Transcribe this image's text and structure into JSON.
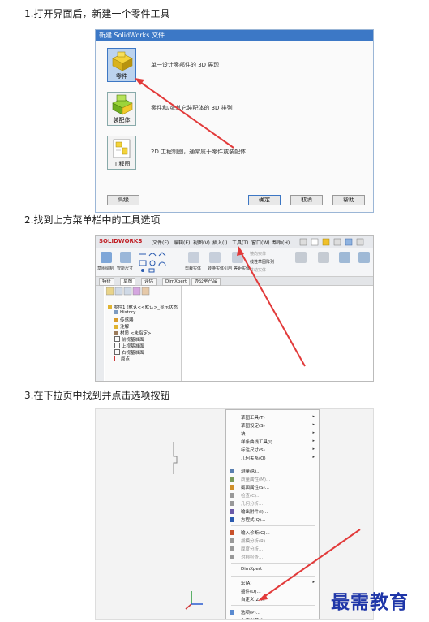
{
  "steps": {
    "s1": "1.打开界面后，新建一个零件工具",
    "s2": "2.找到上方菜单栏中的工具选项",
    "s3": "3.在下拉页中找到并点击选项按钮"
  },
  "dialog": {
    "title": "新建 SolidWorks 文件",
    "items": [
      {
        "label": "零件",
        "desc": "单一设计零部件的 3D 展现"
      },
      {
        "label": "装配体",
        "desc": "零件和/或其它装配体的 3D 排列"
      },
      {
        "label": "工程图",
        "desc": "2D 工程制图，通常属于零件或装配体"
      }
    ],
    "buttons": {
      "advanced": "高级",
      "ok": "确定",
      "cancel": "取消",
      "help": "帮助"
    }
  },
  "app": {
    "logo": "SOLIDWORKS",
    "menus": [
      "文件(F)",
      "编辑(E)",
      "视图(V)",
      "插入(I)",
      "工具(T)",
      "窗口(W)",
      "帮助(H)"
    ],
    "toolbar_labels": [
      "草图绘制",
      "智能尺寸",
      "剪裁实体",
      "转换实体引用",
      "等距实体",
      "镜向实体",
      "线性草图阵列",
      "移动实体",
      "显示/删除几何关系",
      "修复草图",
      "快速捕捉",
      "快速草图"
    ],
    "tabs": [
      "特征",
      "草图",
      "评估",
      "DimXpert",
      "办公室产品"
    ],
    "tree": [
      "零件1 (默认<<默认>_显示状态",
      "History",
      "传感器",
      "注解",
      "材质 <未指定>",
      "前视基准面",
      "上视基准面",
      "右视基准面",
      "原点"
    ]
  },
  "menu": {
    "items": [
      {
        "label": "草图工具(T)",
        "sub": true,
        "dis": false
      },
      {
        "label": "草图设定(S)",
        "sub": true,
        "dis": false
      },
      {
        "label": "块",
        "sub": true,
        "dis": false
      },
      {
        "label": "样条曲线工具(I)",
        "sub": true,
        "dis": false
      },
      {
        "label": "标注尺寸(S)",
        "sub": true,
        "dis": false
      },
      {
        "label": "几何关系(O)",
        "sub": true,
        "dis": false
      },
      {
        "label": "测量(R)...",
        "sub": false,
        "dis": false
      },
      {
        "label": "质量属性(M)...",
        "sub": false,
        "dis": true
      },
      {
        "label": "截面属性(S)...",
        "sub": false,
        "dis": false
      },
      {
        "label": "检查(C)...",
        "sub": false,
        "dis": true
      },
      {
        "label": "几何分析...",
        "sub": false,
        "dis": true
      },
      {
        "label": "输出附件(I)...",
        "sub": false,
        "dis": false
      },
      {
        "label": "方程式(Q)...",
        "sub": false,
        "dis": false
      },
      {
        "label": "输入诊断(G)...",
        "sub": false,
        "dis": false
      },
      {
        "label": "拔模分析(R)...",
        "sub": false,
        "dis": true
      },
      {
        "label": "厚度分析...",
        "sub": false,
        "dis": true
      },
      {
        "label": "对称检查...",
        "sub": false,
        "dis": true
      },
      {
        "label": "DimXpert",
        "sub": false,
        "dis": false
      },
      {
        "label": "宏(A)",
        "sub": true,
        "dis": false
      },
      {
        "label": "插件(D)...",
        "sub": false,
        "dis": false
      },
      {
        "label": "自定义(Z)...",
        "sub": false,
        "dis": false
      },
      {
        "label": "选项(P)...",
        "sub": false,
        "dis": false
      },
      {
        "label": "自定义菜单(M)",
        "sub": false,
        "dis": false
      }
    ]
  },
  "watermark": "最需教育",
  "colors": {
    "arrow": "#e23a3a",
    "watermark": "#1f36a8",
    "selection": "#bcd3ee"
  }
}
